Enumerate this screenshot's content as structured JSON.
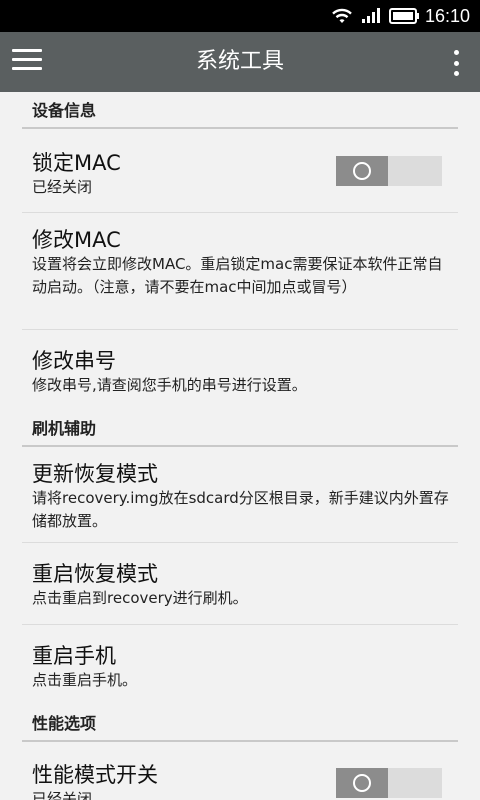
{
  "status_bar": {
    "time": "16:10",
    "icons": [
      "wifi-icon",
      "signal-icon",
      "battery-icon"
    ]
  },
  "app_bar": {
    "title": "系统工具",
    "menu_icon": "hamburger-menu-icon",
    "overflow_icon": "more-vert-icon"
  },
  "sections": [
    {
      "header": "设备信息",
      "items": [
        {
          "title": "锁定MAC",
          "summary": "已经关闭",
          "toggle": false
        },
        {
          "title": "修改MAC",
          "summary": "设置将会立即修改MAC。重启锁定mac需要保证本软件正常自动启动。（注意，请不要在mac中间加点或冒号）"
        },
        {
          "title": "修改串号",
          "summary": "修改串号,请查阅您手机的串号进行设置。"
        }
      ]
    },
    {
      "header": "刷机辅助",
      "items": [
        {
          "title": "更新恢复模式",
          "summary": "请将recovery.img放在sdcard分区根目录，新手建议内外置存储都放置。"
        },
        {
          "title": "重启恢复模式",
          "summary": "点击重启到recovery进行刷机。"
        },
        {
          "title": "重启手机",
          "summary": "点击重启手机。"
        }
      ]
    },
    {
      "header": "性能选项",
      "items": [
        {
          "title": "性能模式开关",
          "summary": "已经关闭",
          "toggle": false
        }
      ]
    }
  ],
  "colors": {
    "app_bar": "#5a5f60",
    "background": "#f2f2f2",
    "toggle_off_knob": "#8c8c8c",
    "toggle_track": "#dcdcdc"
  }
}
